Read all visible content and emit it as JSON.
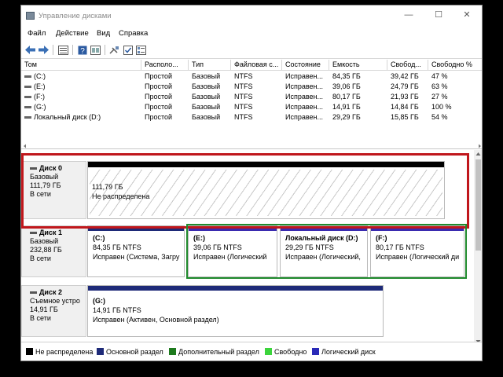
{
  "window": {
    "title": "Управление дисками",
    "controls": {
      "minimize": "—",
      "maximize": "☐",
      "close": "✕"
    }
  },
  "menu": [
    "Файл",
    "Действие",
    "Вид",
    "Справка"
  ],
  "toolbar_icons": [
    "back-arrow-icon",
    "forward-arrow-icon",
    "list-view-icon",
    "help-icon",
    "properties-icon",
    "connect-icon",
    "checklist-icon",
    "details-icon"
  ],
  "volume_table": {
    "columns": [
      "Том",
      "Располо...",
      "Тип",
      "Файловая с...",
      "Состояние",
      "Емкость",
      "Свобод...",
      "Свободно %"
    ],
    "rows": [
      [
        "(C:)",
        "Простой",
        "Базовый",
        "NTFS",
        "Исправен...",
        "84,35 ГБ",
        "39,42 ГБ",
        "47 %"
      ],
      [
        "(E:)",
        "Простой",
        "Базовый",
        "NTFS",
        "Исправен...",
        "39,06 ГБ",
        "24,79 ГБ",
        "63 %"
      ],
      [
        "(F:)",
        "Простой",
        "Базовый",
        "NTFS",
        "Исправен...",
        "80,17 ГБ",
        "21,93 ГБ",
        "27 %"
      ],
      [
        "(G:)",
        "Простой",
        "Базовый",
        "NTFS",
        "Исправен...",
        "14,91 ГБ",
        "14,84 ГБ",
        "100 %"
      ],
      [
        "Локальный диск (D:)",
        "Простой",
        "Базовый",
        "NTFS",
        "Исправен...",
        "29,29 ГБ",
        "15,85 ГБ",
        "54 %"
      ]
    ]
  },
  "disks": [
    {
      "name": "Диск 0",
      "type": "Базовый",
      "size": "111,79 ГБ",
      "status": "В сети",
      "partitions": [
        {
          "name": "",
          "size": "111,79 ГБ",
          "status": "Не распределена",
          "kind": "unallocated",
          "bar_color": "#000000"
        }
      ]
    },
    {
      "name": "Диск 1",
      "type": "Базовый",
      "size": "232,88 ГБ",
      "status": "В сети",
      "partitions": [
        {
          "name": "(C:)",
          "size": "84,35 ГБ NTFS",
          "status": "Исправен (Система, Загру",
          "kind": "primary",
          "bar_color": "#1e2a78"
        },
        {
          "name": "(E:)",
          "size": "39,06 ГБ NTFS",
          "status": "Исправен (Логический",
          "kind": "logical",
          "bar_color": "#3a2bb0"
        },
        {
          "name": "Локальный диск (D:)",
          "size": "29,29 ГБ NTFS",
          "status": "Исправен (Логический,",
          "kind": "logical",
          "bar_color": "#3a2bb0"
        },
        {
          "name": "(F:)",
          "size": "80,17 ГБ NTFS",
          "status": "Исправен (Логический ди",
          "kind": "logical",
          "bar_color": "#3a2bb0"
        }
      ]
    },
    {
      "name": "Диск 2",
      "type": "Съемное устро",
      "size": "14,91 ГБ",
      "status": "В сети",
      "partitions": [
        {
          "name": "(G:)",
          "size": "14,91 ГБ NTFS",
          "status": "Исправен (Активен, Основной раздел)",
          "kind": "primary",
          "bar_color": "#1e2a78"
        }
      ]
    }
  ],
  "legend": [
    {
      "label": "Не распределена",
      "color": "#000000"
    },
    {
      "label": "Основной раздел",
      "color": "#1e2a78"
    },
    {
      "label": "Дополнительный раздел",
      "color": "#1e7a1e"
    },
    {
      "label": "Свободно",
      "color": "#3cd43c"
    },
    {
      "label": "Логический диск",
      "color": "#2a2ab8"
    }
  ],
  "colors": {
    "highlight_red": "#c0171c",
    "highlight_green": "#1f8a2c",
    "extended_partition": "#1e7a1e"
  }
}
